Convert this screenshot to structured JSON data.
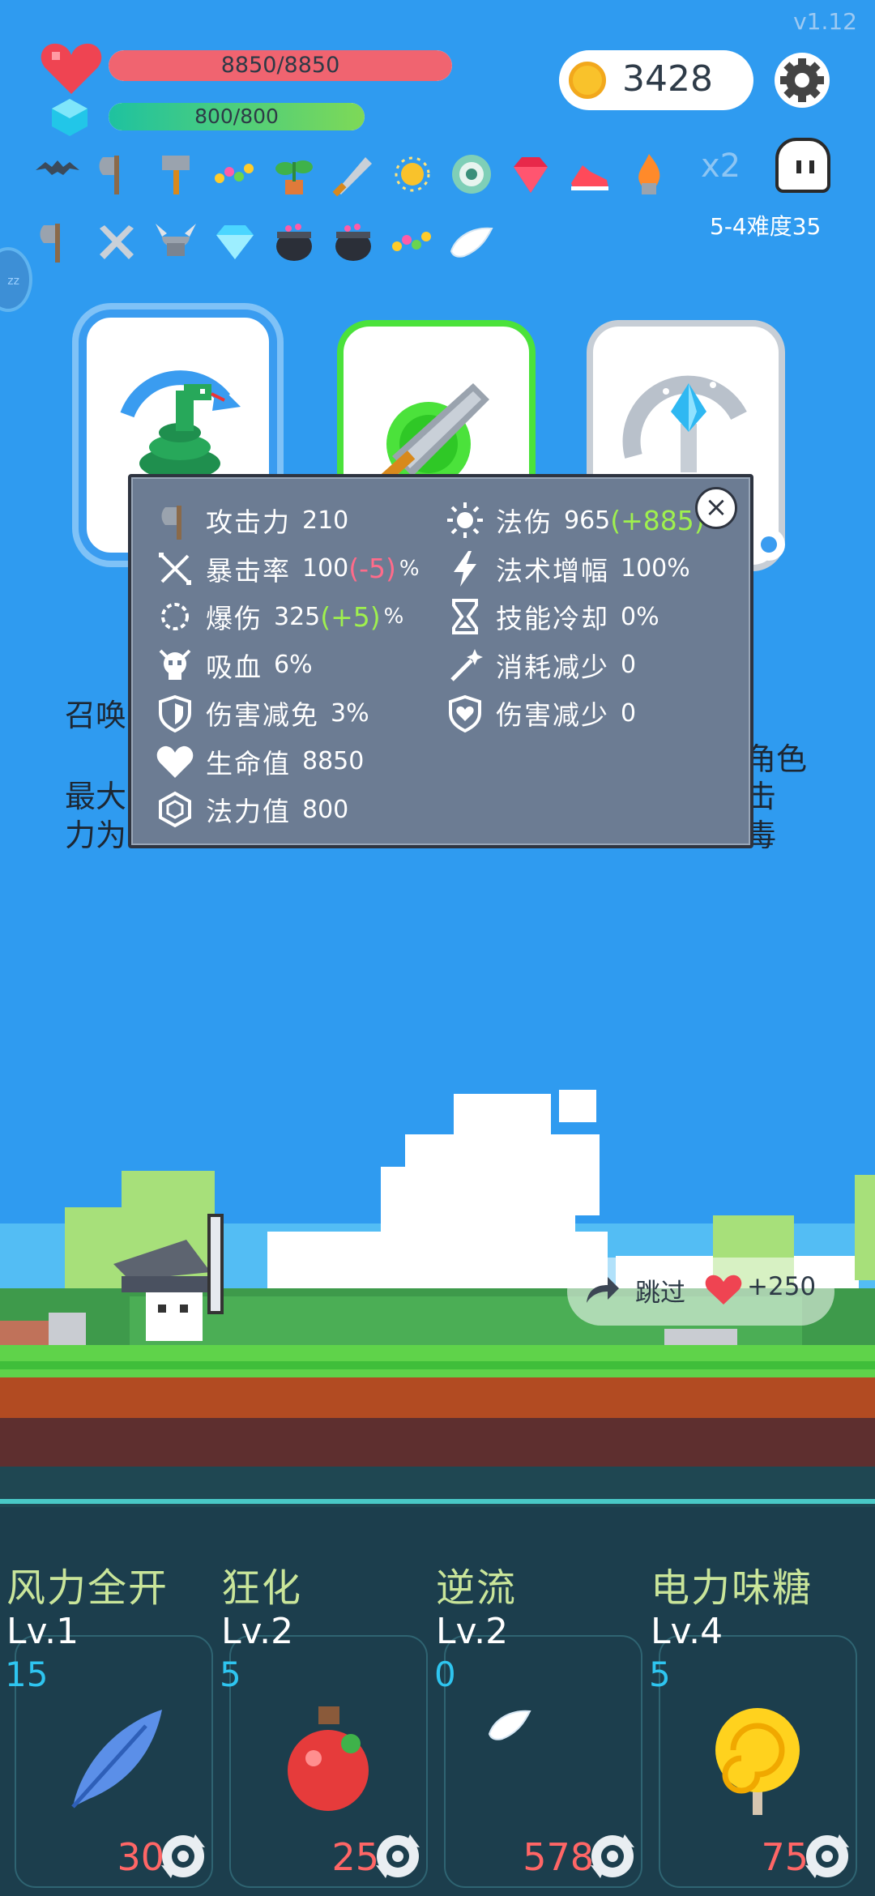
{
  "version": "v1.12",
  "player": {
    "hp": {
      "current": 8850,
      "max": 8850,
      "label": "8850/8850",
      "fraction": 1.0
    },
    "mp": {
      "current": 800,
      "max": 800,
      "label": "800/800",
      "fraction": 1.0
    }
  },
  "gold": "3428",
  "items_row1": [
    "bat-icon",
    "axe-icon",
    "hammer-icon",
    "beads-icon",
    "plant-icon",
    "sword-icon",
    "sun-orb-icon",
    "disc-icon",
    "ruby-icon",
    "shoe-icon",
    "flame-icon"
  ],
  "items_row2": [
    "axe-icon",
    "crossed-swords-icon",
    "horned-helmet-icon",
    "diamond-icon",
    "cauldron-icon",
    "cauldron-icon",
    "beads-icon",
    "wing-icon"
  ],
  "multiplier": "x2",
  "stage": "5-4难度35",
  "side_badge": "zz",
  "cards": [
    {
      "icon": "snake-icon",
      "selected": true
    },
    {
      "icon": "sword-icon",
      "selected": false
    },
    {
      "icon": "crystal-staff-icon",
      "selected": false
    }
  ],
  "stats": {
    "left": [
      {
        "icon": "axe-icon",
        "label": "攻击力",
        "value": "210",
        "mod": "",
        "unit": ""
      },
      {
        "icon": "crit-icon",
        "label": "暴击率",
        "value": "100",
        "mod": "(-5)",
        "mod_type": "neg",
        "unit": "%"
      },
      {
        "icon": "burst-icon",
        "label": "爆伤",
        "value": "325",
        "mod": "(+5)",
        "mod_type": "pos",
        "unit": "%"
      },
      {
        "icon": "skull-icon",
        "label": "吸血",
        "value": "6%",
        "mod": "",
        "unit": ""
      },
      {
        "icon": "shield-icon",
        "label": "伤害减免",
        "value": "3%",
        "mod": "",
        "unit": ""
      },
      {
        "icon": "heart-icon",
        "label": "生命值",
        "value": "8850",
        "mod": "",
        "unit": ""
      },
      {
        "icon": "hexagon-icon",
        "label": "法力值",
        "value": "800",
        "mod": "",
        "unit": ""
      }
    ],
    "right": [
      {
        "icon": "sun-icon",
        "label": "法伤",
        "value": "965",
        "mod": "(+885)",
        "mod_type": "pos",
        "unit": ""
      },
      {
        "icon": "lightning-icon",
        "label": "法术增幅",
        "value": "100%",
        "mod": "",
        "unit": ""
      },
      {
        "icon": "hourglass-icon",
        "label": "技能冷却",
        "value": "0%",
        "mod": "",
        "unit": ""
      },
      {
        "icon": "wand-icon",
        "label": "消耗减少",
        "value": "0",
        "mod": "",
        "unit": ""
      },
      {
        "icon": "heart-shield-icon",
        "label": "伤害减少",
        "value": "0",
        "mod": "",
        "unit": ""
      }
    ],
    "close": "×"
  },
  "background_text": {
    "left_1": "召唤",
    "left_2": "最大",
    "left_3": "力为",
    "right_1": "角色",
    "right_2": "击",
    "right_3": "毒"
  },
  "skip": {
    "label": "跳过",
    "bonus": "+250"
  },
  "skills": [
    {
      "name": "风力全开",
      "level": "Lv.1",
      "count": "15",
      "cost": "30",
      "icon": "feather-icon"
    },
    {
      "name": "狂化",
      "level": "Lv.2",
      "count": "5",
      "cost": "25",
      "icon": "potion-icon"
    },
    {
      "name": "逆流",
      "level": "Lv.2",
      "count": "0",
      "cost": "578",
      "icon": "wing-icon"
    },
    {
      "name": "电力味糖",
      "level": "Lv.4",
      "count": "5",
      "cost": "75",
      "icon": "lollipop-icon"
    }
  ]
}
